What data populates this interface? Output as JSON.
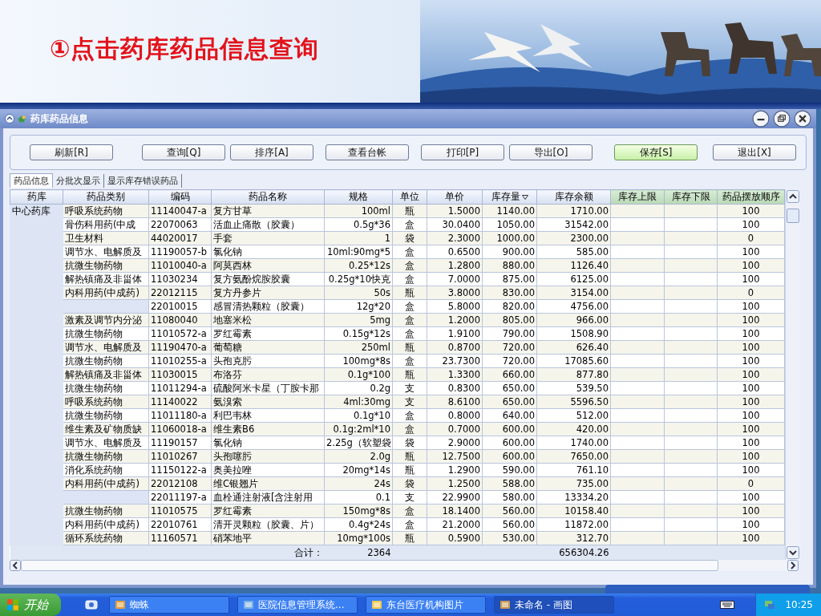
{
  "banner": {
    "heading": "①点击药库药品信息查询"
  },
  "window": {
    "title": "药库药品信息"
  },
  "toolbar": [
    {
      "label": "刷新[R]",
      "highlighted": false
    },
    {
      "label": "查询[Q]",
      "highlighted": false
    },
    {
      "label": "排序[A]",
      "highlighted": false
    },
    {
      "label": "查看台帐",
      "highlighted": false
    },
    {
      "label": "打印[P]",
      "highlighted": false
    },
    {
      "label": "导出[O]",
      "highlighted": false
    },
    {
      "label": "保存[S]",
      "highlighted": true
    },
    {
      "label": "退出[X]",
      "highlighted": false
    }
  ],
  "tabs": [
    {
      "label": "药品信息",
      "selected": true
    },
    {
      "label": "分批次显示",
      "selected": false
    },
    {
      "label": "显示库存错误药品",
      "selected": false
    }
  ],
  "table": {
    "columns": [
      {
        "label": "药库",
        "sorted": false,
        "highlighted": false
      },
      {
        "label": "药品类别",
        "sorted": false,
        "highlighted": false
      },
      {
        "label": "编码",
        "sorted": false,
        "highlighted": false
      },
      {
        "label": "药品名称",
        "sorted": false,
        "highlighted": false
      },
      {
        "label": "规格",
        "sorted": false,
        "highlighted": false
      },
      {
        "label": "单位",
        "sorted": false,
        "highlighted": false
      },
      {
        "label": "单价",
        "sorted": false,
        "highlighted": false
      },
      {
        "label": "库存量",
        "sorted": true,
        "highlighted": false
      },
      {
        "label": "库存余额",
        "sorted": false,
        "highlighted": false
      },
      {
        "label": "库存上限",
        "sorted": false,
        "highlighted": true
      },
      {
        "label": "库存下限",
        "sorted": false,
        "highlighted": true
      },
      {
        "label": "药品摆放顺序",
        "sorted": false,
        "highlighted": true
      }
    ],
    "rows": [
      {
        "store": "中心药库",
        "category": "呼吸系统药物",
        "code": "11140047-a",
        "name": "复方甘草",
        "spec": "100ml",
        "unit": "瓶",
        "price": "1.5000",
        "qty": "1140.00",
        "amount": "1710.00",
        "order": "100"
      },
      {
        "category": "骨伤科用药(中成",
        "code": "22070063",
        "name": "活血止痛散（胶囊）",
        "spec": "0.5g*36",
        "unit": "盒",
        "price": "30.0400",
        "qty": "1050.00",
        "amount": "31542.00",
        "order": "100"
      },
      {
        "category": "卫生材料",
        "code": "44020017",
        "name": "手套",
        "spec": "1",
        "unit": "袋",
        "price": "2.3000",
        "qty": "1000.00",
        "amount": "2300.00",
        "order": "0"
      },
      {
        "category": "调节水、电解质及",
        "code": "11190057-b",
        "name": "氯化钠",
        "spec": "10ml:90mg*5",
        "unit": "盒",
        "price": "0.6500",
        "qty": "900.00",
        "amount": "585.00",
        "order": "100"
      },
      {
        "category": "抗微生物药物",
        "code": "11010040-a",
        "name": "阿莫西林",
        "spec": "0.25*12s",
        "unit": "盒",
        "price": "1.2800",
        "qty": "880.00",
        "amount": "1126.40",
        "order": "100"
      },
      {
        "category": "解热镇痛及非甾体",
        "code": "11030234",
        "name": "复方氨酚烷胺胶囊",
        "spec": "0.25g*10快克",
        "unit": "盒",
        "price": "7.0000",
        "qty": "875.00",
        "amount": "6125.00",
        "order": "100"
      },
      {
        "category": "内科用药(中成药)",
        "code": "22012115",
        "name": "复方丹参片",
        "spec": "50s",
        "unit": "瓶",
        "price": "3.8000",
        "qty": "830.00",
        "amount": "3154.00",
        "order": "0"
      },
      {
        "code": "22010015",
        "name": "感冒清热颗粒（胶囊）",
        "spec": "12g*20",
        "unit": "盒",
        "price": "5.8000",
        "qty": "820.00",
        "amount": "4756.00",
        "order": "100"
      },
      {
        "category": "激素及调节内分泌",
        "code": "11080040",
        "name": "地塞米松",
        "spec": "5mg",
        "unit": "盒",
        "price": "1.2000",
        "qty": "805.00",
        "amount": "966.00",
        "order": "100"
      },
      {
        "category": "抗微生物药物",
        "code": "11010572-a",
        "name": "罗红霉素",
        "spec": "0.15g*12s",
        "unit": "盒",
        "price": "1.9100",
        "qty": "790.00",
        "amount": "1508.90",
        "order": "100"
      },
      {
        "category": "调节水、电解质及",
        "code": "11190470-a",
        "name": "葡萄糖",
        "spec": "250ml",
        "unit": "瓶",
        "price": "0.8700",
        "qty": "720.00",
        "amount": "626.40",
        "order": "100"
      },
      {
        "category": "抗微生物药物",
        "code": "11010255-a",
        "name": "头孢克肟",
        "spec": "100mg*8s",
        "unit": "盒",
        "price": "23.7300",
        "qty": "720.00",
        "amount": "17085.60",
        "order": "100"
      },
      {
        "category": "解热镇痛及非甾体",
        "code": "11030015",
        "name": "布洛芬",
        "spec": "0.1g*100",
        "unit": "瓶",
        "price": "1.3300",
        "qty": "660.00",
        "amount": "877.80",
        "order": "100"
      },
      {
        "category": "抗微生物药物",
        "code": "11011294-a",
        "name": "硫酸阿米卡星（丁胺卡那",
        "spec": "0.2g",
        "unit": "支",
        "price": "0.8300",
        "qty": "650.00",
        "amount": "539.50",
        "order": "100"
      },
      {
        "category": "呼吸系统药物",
        "code": "11140022",
        "name": "氨溴索",
        "spec": "4ml:30mg",
        "unit": "支",
        "price": "8.6100",
        "qty": "650.00",
        "amount": "5596.50",
        "order": "100"
      },
      {
        "category": "抗微生物药物",
        "code": "11011180-a",
        "name": "利巴韦林",
        "spec": "0.1g*10",
        "unit": "盒",
        "price": "0.8000",
        "qty": "640.00",
        "amount": "512.00",
        "order": "100"
      },
      {
        "category": "维生素及矿物质缺",
        "code": "11060018-a",
        "name": "维生素B6",
        "spec": "0.1g:2ml*10",
        "unit": "盒",
        "price": "0.7000",
        "qty": "600.00",
        "amount": "420.00",
        "order": "100"
      },
      {
        "category": "调节水、电解质及",
        "code": "11190157",
        "name": "氯化钠",
        "spec": "2.25g（软塑袋",
        "unit": "袋",
        "price": "2.9000",
        "qty": "600.00",
        "amount": "1740.00",
        "order": "100"
      },
      {
        "category": "抗微生物药物",
        "code": "11010267",
        "name": "头孢噻肟",
        "spec": "2.0g",
        "unit": "瓶",
        "price": "12.7500",
        "qty": "600.00",
        "amount": "7650.00",
        "order": "100"
      },
      {
        "category": "消化系统药物",
        "code": "11150122-a",
        "name": "奥美拉唑",
        "spec": "20mg*14s",
        "unit": "瓶",
        "price": "1.2900",
        "qty": "590.00",
        "amount": "761.10",
        "order": "100"
      },
      {
        "category": "内科用药(中成药)",
        "code": "22012108",
        "name": "维C银翘片",
        "spec": "24s",
        "unit": "袋",
        "price": "1.2500",
        "qty": "588.00",
        "amount": "735.00",
        "order": "0"
      },
      {
        "code": "22011197-a",
        "name": "血栓通注射液[含注射用",
        "spec": "0.1",
        "unit": "支",
        "price": "22.9900",
        "qty": "580.00",
        "amount": "13334.20",
        "order": "100"
      },
      {
        "category": "抗微生物药物",
        "code": "11010575",
        "name": "罗红霉素",
        "spec": "150mg*8s",
        "unit": "盒",
        "price": "18.1400",
        "qty": "560.00",
        "amount": "10158.40",
        "order": "100"
      },
      {
        "category": "内科用药(中成药)",
        "code": "22010761",
        "name": "清开灵颗粒（胶囊、片）",
        "spec": "0.4g*24s",
        "unit": "盒",
        "price": "21.2000",
        "qty": "560.00",
        "amount": "11872.00",
        "order": "100"
      },
      {
        "category": "循环系统药物",
        "code": "11160571",
        "name": "硝苯地平",
        "spec": "10mg*100s",
        "unit": "瓶",
        "price": "0.5900",
        "qty": "530.00",
        "amount": "312.70",
        "order": "100"
      }
    ],
    "total": {
      "label": "合计：",
      "qty": "2364",
      "amount": "656304.26"
    }
  },
  "taskbar": {
    "start": "开始",
    "tasks": [
      {
        "label": "蜘蛛",
        "selected": false
      },
      {
        "label": "医院信息管理系统...",
        "selected": false
      },
      {
        "label": "东台医疗机构图片",
        "selected": false
      },
      {
        "label": "未命名 - 画图",
        "selected": true
      }
    ],
    "clock": "10:25"
  }
}
